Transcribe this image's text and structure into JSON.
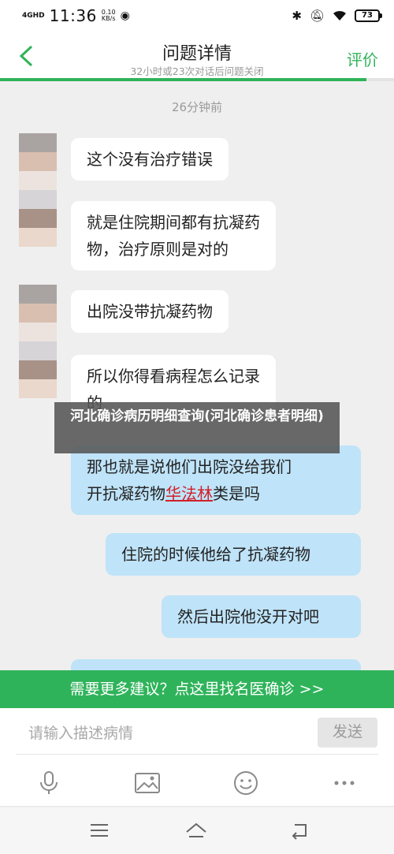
{
  "status_bar": {
    "network": "4GHD",
    "time": "11:36",
    "speed_value": "0.10",
    "speed_unit": "KB/s",
    "battery": "73"
  },
  "header": {
    "title": "问题详情",
    "subtitle": "32小时或23次对话后问题关闭",
    "rate_label": "评价",
    "progress_fraction": 0.93
  },
  "chat": {
    "timestamp": "26分钟前",
    "messages": [
      {
        "side": "left",
        "text": "这个没有治疗错误"
      },
      {
        "side": "left",
        "lines": [
          "就是住院期间都有抗凝药",
          "物，治疗原则是对的"
        ]
      },
      {
        "side": "left",
        "text": "出院没带抗凝药物"
      },
      {
        "side": "left",
        "lines": [
          "所以你得看病程怎么记录",
          "的"
        ]
      },
      {
        "side": "right",
        "line1": "那也就是说他们出院没给我们",
        "line2_pre": "开抗凝药物",
        "line2_highlight": "华法林",
        "line2_post": "类是吗"
      },
      {
        "side": "right",
        "text": "住院的时候他给了抗凝药物"
      },
      {
        "side": "right",
        "text": "然后出院他没开对吧"
      }
    ]
  },
  "overlay_caption": "河北确诊病历明细查询(河北确诊患者明细)",
  "banner": "需要更多建议？点这里找名医确诊 >>",
  "input": {
    "placeholder": "请输入描述病情",
    "send_label": "发送"
  },
  "icons": {
    "toolbar": [
      "microphone-icon",
      "image-icon",
      "emoji-icon",
      "more-icon"
    ],
    "navbar": [
      "menu-icon",
      "home-icon",
      "back-nav-icon"
    ]
  },
  "colors": {
    "accent": "#2fb35a",
    "bubble_right": "#bfe3f8",
    "bubble_left": "#ffffff",
    "highlight": "#d0202a"
  }
}
